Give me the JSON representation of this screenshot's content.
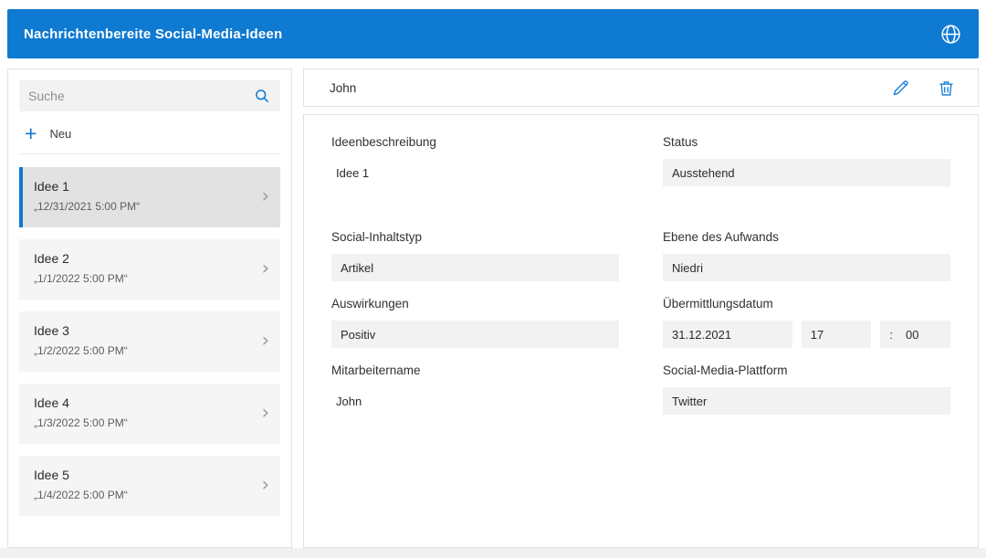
{
  "colors": {
    "header_bg": "#0f7ad1",
    "accent": "#0f7ad1",
    "field_bg": "#f2f2f2"
  },
  "header": {
    "title": "Nachrichtenbereite Social-Media-Ideen",
    "icon": "globe-icon"
  },
  "sidebar": {
    "search": {
      "placeholder": "Suche",
      "icon": "search-icon"
    },
    "new_button": {
      "label": "Neu",
      "icon": "plus-icon"
    },
    "items": [
      {
        "title": "Idee 1",
        "subtitle": "„12/31/2021 5:00 PM“",
        "selected": true
      },
      {
        "title": "Idee 2",
        "subtitle": "„1/1/2022 5:00 PM“",
        "selected": false
      },
      {
        "title": "Idee 3",
        "subtitle": "„1/2/2022 5:00 PM“",
        "selected": false
      },
      {
        "title": "Idee 4",
        "subtitle": "„1/3/2022 5:00 PM“",
        "selected": false
      },
      {
        "title": "Idee 5",
        "subtitle": "„1/4/2022 5:00 PM“",
        "selected": false
      }
    ]
  },
  "detail": {
    "record_title": "John",
    "actions": {
      "edit_icon": "pencil-icon",
      "delete_icon": "trash-icon"
    },
    "fields": {
      "ideenbeschreibung": {
        "label": "Ideenbeschreibung",
        "value": "Idee 1"
      },
      "status": {
        "label": "Status",
        "value": "Ausstehend"
      },
      "social_inhaltstyp": {
        "label": "Social-Inhaltstyp",
        "value": "Artikel"
      },
      "ebene_des_aufwands": {
        "label": "Ebene des Aufwands",
        "value": "Niedri"
      },
      "auswirkungen": {
        "label": "Auswirkungen",
        "value": "Positiv"
      },
      "uebermittlungsdatum": {
        "label": "Übermittlungsdatum",
        "date": "31.12.2021",
        "hour": "17",
        "separator": ":",
        "minute": "00"
      },
      "mitarbeitername": {
        "label": "Mitarbeitername",
        "value": "John"
      },
      "social_media_plattform": {
        "label": "Social-Media-Plattform",
        "value": "Twitter"
      }
    }
  }
}
